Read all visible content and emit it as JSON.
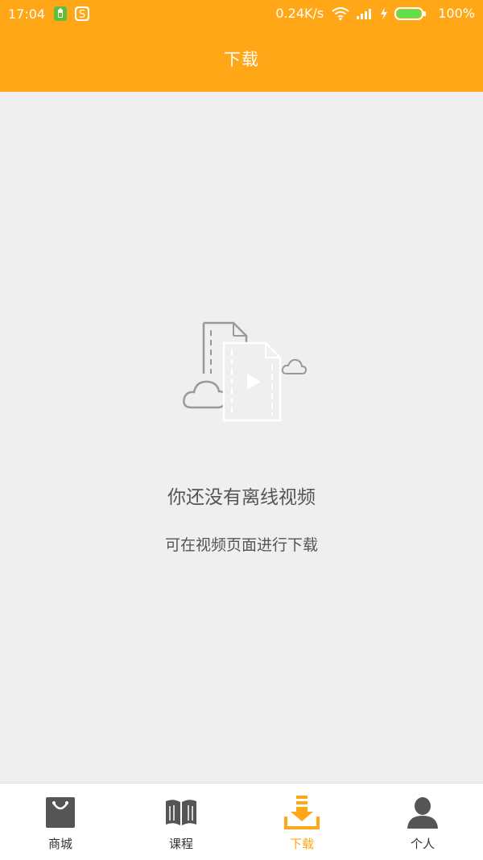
{
  "status_bar": {
    "time": "17:04",
    "net_speed": "0.24K/s",
    "battery": "100%",
    "icons": [
      "battery-saver-icon",
      "sogou-icon",
      "wifi-icon",
      "signal-icon",
      "charging-icon",
      "battery-icon"
    ]
  },
  "header": {
    "title": "下载",
    "color": "#ffa716"
  },
  "empty_state": {
    "title": "你还没有离线视频",
    "subtitle": "可在视频页面进行下载",
    "icon": "offline-video-empty-icon"
  },
  "tabbar": {
    "active_color": "#ffa716",
    "items": [
      {
        "label": "商城",
        "icon": "shopping-bag-icon"
      },
      {
        "label": "课程",
        "icon": "book-icon"
      },
      {
        "label": "下载",
        "icon": "download-icon",
        "active": true
      },
      {
        "label": "个人",
        "icon": "person-icon"
      }
    ]
  }
}
